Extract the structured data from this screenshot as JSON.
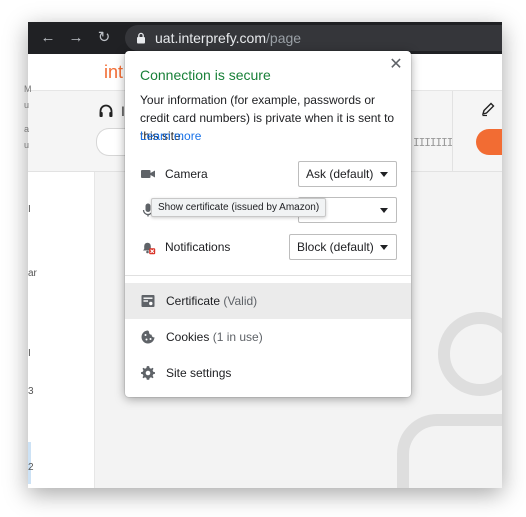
{
  "browser": {
    "url_host": "uat.interprefy.com",
    "url_path": "/page",
    "nav": {
      "back_icon": "arrow-left-icon",
      "forward_icon": "arrow-right-icon",
      "reload_icon": "reload-icon"
    }
  },
  "page": {
    "brand_partial": "int",
    "band_text_partial": "I",
    "volume_bars": "IIIIIII",
    "rail_letters": [
      "I",
      "M",
      "u",
      "a",
      "u",
      "I",
      "ar",
      "I",
      "3",
      "2"
    ],
    "colors": {
      "brand": "#f26c33"
    }
  },
  "popup": {
    "title": "Connection is secure",
    "description": "Your information (for example, passwords or credit card numbers) is private when it is sent to this site.",
    "learn_more": "Learn more",
    "close_icon": "close-icon",
    "permissions": [
      {
        "label": "Camera",
        "value": "Ask (default)",
        "icon": "camera-icon"
      },
      {
        "label": "",
        "value": "",
        "icon": "microphone-icon"
      },
      {
        "label": "Notifications",
        "value": "Block (default)",
        "icon": "notifications-blocked-icon"
      }
    ],
    "tooltip": "Show certificate (issued by Amazon)",
    "menu": [
      {
        "label": "Certificate",
        "detail": "(Valid)",
        "icon": "certificate-icon"
      },
      {
        "label": "Cookies",
        "detail": "(1 in use)",
        "icon": "cookie-icon"
      },
      {
        "label": "Site settings",
        "detail": "",
        "icon": "gear-icon"
      }
    ],
    "colors": {
      "title": "#188038",
      "link": "#1a73e8"
    }
  }
}
